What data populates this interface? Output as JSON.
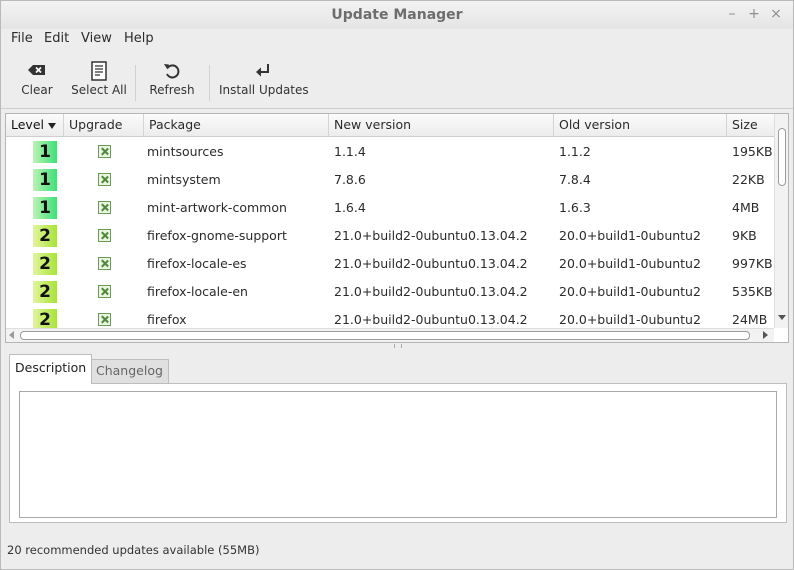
{
  "window": {
    "title": "Update Manager",
    "controls": [
      "–",
      "+",
      "×"
    ]
  },
  "menu": [
    "File",
    "Edit",
    "View",
    "Help"
  ],
  "toolbar": {
    "clear": "Clear",
    "select_all": "Select All",
    "refresh": "Refresh",
    "install": "Install Updates"
  },
  "columns": {
    "level": "Level",
    "upgrade": "Upgrade",
    "package": "Package",
    "new_version": "New version",
    "old_version": "Old version",
    "size": "Size"
  },
  "updates": [
    {
      "level": "1",
      "upgrade": true,
      "package": "mintsources",
      "new_version": "1.1.4",
      "old_version": "1.1.2",
      "size": "195KB"
    },
    {
      "level": "1",
      "upgrade": true,
      "package": "mintsystem",
      "new_version": "7.8.6",
      "old_version": "7.8.4",
      "size": "22KB"
    },
    {
      "level": "1",
      "upgrade": true,
      "package": "mint-artwork-common",
      "new_version": "1.6.4",
      "old_version": "1.6.3",
      "size": "4MB"
    },
    {
      "level": "2",
      "upgrade": true,
      "package": "firefox-gnome-support",
      "new_version": "21.0+build2-0ubuntu0.13.04.2",
      "old_version": "20.0+build1-0ubuntu2",
      "size": "9KB"
    },
    {
      "level": "2",
      "upgrade": true,
      "package": "firefox-locale-es",
      "new_version": "21.0+build2-0ubuntu0.13.04.2",
      "old_version": "20.0+build1-0ubuntu2",
      "size": "997KB"
    },
    {
      "level": "2",
      "upgrade": true,
      "package": "firefox-locale-en",
      "new_version": "21.0+build2-0ubuntu0.13.04.2",
      "old_version": "20.0+build1-0ubuntu2",
      "size": "535KB"
    },
    {
      "level": "2",
      "upgrade": true,
      "package": "firefox",
      "new_version": "21.0+build2-0ubuntu0.13.04.2",
      "old_version": "20.0+build1-0ubuntu2",
      "size": "24MB"
    }
  ],
  "tabs": {
    "description": "Description",
    "changelog": "Changelog"
  },
  "status": "20 recommended updates available (55MB)"
}
